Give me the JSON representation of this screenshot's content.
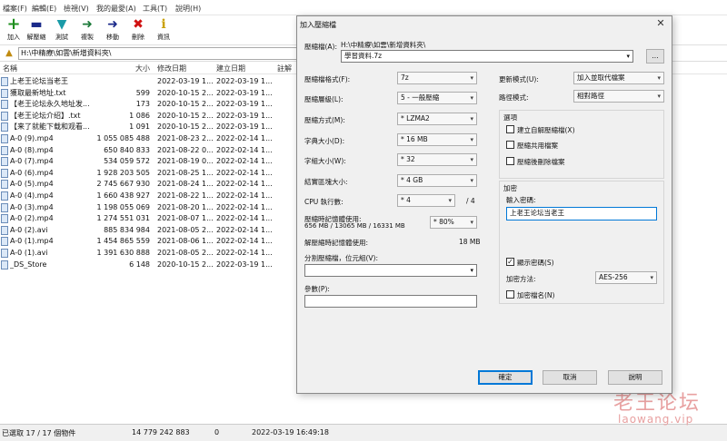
{
  "menu": [
    "檔案(F)",
    "編輯(E)",
    "檢視(V)",
    "我的最愛(A)",
    "工具(T)",
    "說明(H)"
  ],
  "toolbar": {
    "add": {
      "label": "加入",
      "icon": "+"
    },
    "extract": {
      "label": "解壓縮",
      "icon": "▬"
    },
    "test": {
      "label": "測試",
      "icon": "▼"
    },
    "copy": {
      "label": "複製",
      "icon": "➜"
    },
    "move": {
      "label": "移動",
      "icon": "➜"
    },
    "delete": {
      "label": "刪除",
      "icon": "✖"
    },
    "info": {
      "label": "資訊",
      "icon": "i"
    }
  },
  "address": {
    "path": "H:\\中精療\\如雲\\新增資料夾\\"
  },
  "columns": {
    "name": "名稱",
    "size": "大小",
    "modified": "修改日期",
    "created": "建立日期",
    "comment": "註解"
  },
  "files": [
    {
      "name": "上老王论坛当老王",
      "size": "",
      "modified": "2022-03-19 1...",
      "created": "2022-03-19 1..."
    },
    {
      "name": "獲取最新地址.txt",
      "size": "599",
      "modified": "2020-10-15 2...",
      "created": "2022-03-19 1..."
    },
    {
      "name": "【老王论坛永久地址发...",
      "size": "173",
      "modified": "2020-10-15 2...",
      "created": "2022-03-19 1..."
    },
    {
      "name": "【老王论坛介绍】.txt",
      "size": "1 086",
      "modified": "2020-10-15 2...",
      "created": "2022-03-19 1..."
    },
    {
      "name": "【来了就能下载和观看...",
      "size": "1 091",
      "modified": "2020-10-15 2...",
      "created": "2022-03-19 1..."
    },
    {
      "name": "A-0 (9).mp4",
      "size": "1 055 085 488",
      "modified": "2021-08-23 2...",
      "created": "2022-02-14 1..."
    },
    {
      "name": "A-0 (8).mp4",
      "size": "650 840 833",
      "modified": "2021-08-22 0...",
      "created": "2022-02-14 1..."
    },
    {
      "name": "A-0 (7).mp4",
      "size": "534 059 572",
      "modified": "2021-08-19 0...",
      "created": "2022-02-14 1..."
    },
    {
      "name": "A-0 (6).mp4",
      "size": "1 928 203 505",
      "modified": "2021-08-25 1...",
      "created": "2022-02-14 1..."
    },
    {
      "name": "A-0 (5).mp4",
      "size": "2 745 667 930",
      "modified": "2021-08-24 1...",
      "created": "2022-02-14 1..."
    },
    {
      "name": "A-0 (4).mp4",
      "size": "1 660 438 927",
      "modified": "2021-08-22 1...",
      "created": "2022-02-14 1..."
    },
    {
      "name": "A-0 (3).mp4",
      "size": "1 198 055 069",
      "modified": "2021-08-20 1...",
      "created": "2022-02-14 1..."
    },
    {
      "name": "A-0 (2).mp4",
      "size": "1 274 551 031",
      "modified": "2021-08-07 1...",
      "created": "2022-02-14 1..."
    },
    {
      "name": "A-0 (2).avi",
      "size": "885 834 984",
      "modified": "2021-08-05 2...",
      "created": "2022-02-14 1..."
    },
    {
      "name": "A-0 (1).mp4",
      "size": "1 454 865 559",
      "modified": "2021-08-06 1...",
      "created": "2022-02-14 1..."
    },
    {
      "name": "A-0 (1).avi",
      "size": "1 391 630 888",
      "modified": "2021-08-05 2...",
      "created": "2022-02-14 1..."
    },
    {
      "name": "_DS_Store",
      "size": "6 148",
      "modified": "2020-10-15 2...",
      "created": "2022-03-19 1..."
    }
  ],
  "status": {
    "selected": "已選取 17 / 17 個物件",
    "total": "14 779 242 883",
    "zero": "0",
    "datetime": "2022-03-19 16:49:18"
  },
  "dialog": {
    "title": "加入壓縮檔",
    "close": "✕",
    "archive_label": "壓縮檔(A):",
    "archive_dir": "H:\\中精療\\如雲\\新增資料夾\\",
    "archive_name": "學習資料.7z",
    "browse": "...",
    "format_label": "壓縮檔格式(F):",
    "format_value": "7z",
    "level_label": "壓縮層級(L):",
    "level_value": "5 - 一般壓縮",
    "method_label": "壓縮方式(M):",
    "method_value": "* LZMA2",
    "dict_label": "字典大小(D):",
    "dict_value": "* 16 MB",
    "word_label": "字組大小(W):",
    "word_value": "* 32",
    "solid_label": "結實區塊大小:",
    "solid_value": "* 4 GB",
    "cpu_label": "CPU 執行數:",
    "cpu_value": "* 4",
    "cpu_total": "/ 4",
    "mem_label": "壓縮時記憶體使用:",
    "mem_detail": "656 MB / 13065 MB / 16331 MB",
    "mem_value": "* 80%",
    "demem_label": "解壓縮時記憶體使用:",
    "demem_value": "18 MB",
    "split_label": "分割壓縮檔，位元組(V):",
    "split_value": "",
    "params_label": "參數(P):",
    "params_value": "",
    "update_label": "更新模式(U):",
    "update_value": "加入並取代檔案",
    "path_label": "路徑模式:",
    "path_value": "相對路徑",
    "options_title": "選項",
    "opt_sfx": "建立自解壓縮檔(X)",
    "opt_shared": "壓縮共用檔案",
    "opt_delete": "壓縮後刪除檔案",
    "enc_title": "加密",
    "pwd_label": "輸入密碼:",
    "pwd_value": "上老王论坛当老王",
    "show_pwd": "顯示密碼(S)",
    "enc_method_label": "加密方法:",
    "enc_method_value": "AES-256",
    "enc_names": "加密檔名(N)",
    "ok": "確定",
    "cancel": "取消",
    "help": "說明"
  },
  "watermark": {
    "line1": "老王论坛",
    "line2": "laowang.vip"
  },
  "colors": {
    "add_icon": "#1f8f1f",
    "extract_icon": "#1b2a8a",
    "test_icon": "#1a9ba8",
    "copy_icon": "#1c7a3a",
    "move_icon": "#1b2a8a",
    "delete_icon": "#d01010",
    "info_icon": "#c9a000",
    "primary_border": "#0078d7"
  }
}
